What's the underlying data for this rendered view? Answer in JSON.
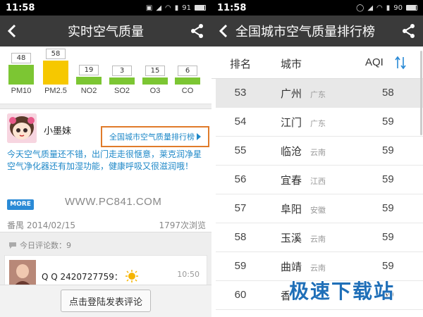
{
  "left": {
    "status": {
      "time": "11:58",
      "battery": "91",
      "battery_level": 0.91
    },
    "title": "实时空气质量",
    "pollutants": [
      {
        "name": "PM10",
        "value": "48",
        "color": "#7cc633"
      },
      {
        "name": "PM2.5",
        "value": "58",
        "color": "#f6c800"
      },
      {
        "name": "NO2",
        "value": "19",
        "color": "#7cc633"
      },
      {
        "name": "SO2",
        "value": "3",
        "color": "#7cc633"
      },
      {
        "name": "O3",
        "value": "15",
        "color": "#7cc633"
      },
      {
        "name": "CO",
        "value": "6",
        "color": "#7cc633"
      }
    ],
    "post": {
      "username": "小墨妹",
      "rank_link": "全国城市空气质量排行榜",
      "text": "今天空气质量还不错，出门走走很惬意，莱克润净星空气净化器还有加湿功能，健康呼吸又很滋润哦！",
      "more": "MORE",
      "watermark": "WWW.PC841.COM",
      "location_date": "番禺  2014/02/15",
      "views": "1797次浏览"
    },
    "comments_count": "今日评论数：9",
    "comment": {
      "user": "Q Q 2420727759：",
      "time": "10:50"
    },
    "login_button": "点击登陆发表评论"
  },
  "right": {
    "status": {
      "time": "11:58",
      "battery": "90",
      "battery_level": 0.9
    },
    "title": "全国城市空气质量排行榜",
    "headers": {
      "rank": "排名",
      "city": "城市",
      "aqi": "AQI"
    },
    "rows": [
      {
        "rank": "53",
        "city": "广州",
        "province": "广东",
        "aqi": "58"
      },
      {
        "rank": "54",
        "city": "江门",
        "province": "广东",
        "aqi": "59"
      },
      {
        "rank": "55",
        "city": "临沧",
        "province": "云南",
        "aqi": "59"
      },
      {
        "rank": "56",
        "city": "宜春",
        "province": "江西",
        "aqi": "59"
      },
      {
        "rank": "57",
        "city": "阜阳",
        "province": "安徽",
        "aqi": "59"
      },
      {
        "rank": "58",
        "city": "玉溪",
        "province": "云南",
        "aqi": "59"
      },
      {
        "rank": "59",
        "city": "曲靖",
        "province": "云南",
        "aqi": "59"
      },
      {
        "rank": "60",
        "city": "香",
        "province": "",
        "aqi": "59"
      }
    ],
    "site_watermark": "极速下载站"
  }
}
